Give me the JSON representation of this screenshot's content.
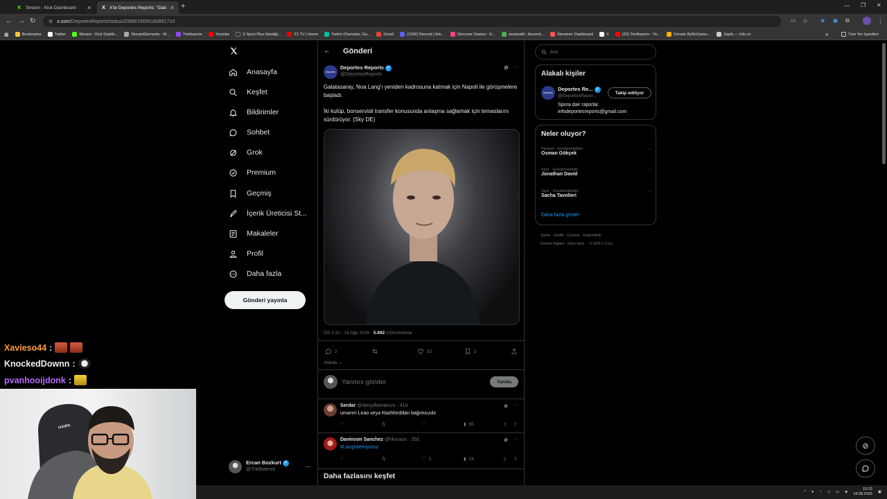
{
  "browser": {
    "tabs": [
      {
        "label": "Stream - Kick Dashboard",
        "favicon": "K"
      },
      {
        "label": "X'te Deportes Reports: \"Galata...",
        "favicon": "X"
      }
    ],
    "new_tab": "+",
    "url_domain": "x.com",
    "url_path": "/DeportesReports/status/2089676656180891710",
    "bookmarks": [
      "Bookmarks",
      "Twitter",
      "Stream - Kick Dashb...",
      "StreamElements - M...",
      "Trielbaenre",
      "Youtube",
      "S Sport Plus-İstediği...",
      "F1 TV | Home",
      "Twitch Channels, Ga...",
      "Gmail",
      "(1342) Discord | Ark...",
      "Discover Games - K...",
      "wowaudit - Ascend...",
      "Streamer Dashboard",
      "X",
      "(23) Trielbaenre - Yo...",
      "Donate ByNoGame...",
      "Sayfa — hits.co"
    ],
    "bookmarks_more": "»",
    "all_bookmarks": "Tüm Yer İşaretleri"
  },
  "nav": {
    "items": [
      "Anasayfa",
      "Keşfet",
      "Bildirimler",
      "Sohbet",
      "Grok",
      "Premium",
      "Geçmiş",
      "İçerik Üreticisi St...",
      "Makaleler",
      "Profil",
      "Daha fazla"
    ],
    "post_button": "Gönderi yayınla",
    "account_name": "Ercan Bozkurt",
    "account_handle": "@Trielbaenre",
    "account_more": "···"
  },
  "post": {
    "header_title": "Gönderi",
    "author_name": "Deportes Reports",
    "author_handle": "@DeportesReports",
    "avatar_text": "Deportes",
    "text_p1": "Galatasaray, Noa Lang'ı yeniden kadrosuna katmak için Napoli ile görüşmelere başladı.",
    "text_p2": "İki kulüp, bonservisli transfer konusunda anlaşma sağlamak için temaslarını sürdürüyor. (Sky DE)",
    "timestamp": "ÖS 2:31 · 18 Ağu 2026 ·",
    "views_count": "5.892",
    "views_label": "Görüntüleme",
    "replies": "2",
    "likes": "32",
    "bookmarks": "2",
    "related_label": "Alakalı",
    "reply_placeholder": "Yanıtını gönder",
    "reply_button": "Yanıtla"
  },
  "replies": [
    {
      "name": "Serdar",
      "handle": "@AlexyBatrakovv",
      "time": "· 41d",
      "text": "umarım Leao veya Rashforddan bağımsızdır",
      "likes": "",
      "views": "85"
    },
    {
      "name": "Davinson Sanchez",
      "handle": "@hkoraus",
      "time": "· 26d",
      "text": "#LangIstemiyoruz",
      "likes": "1",
      "views": "24"
    }
  ],
  "discover_more": "Daha fazlasını keşfet",
  "sidebar": {
    "search_placeholder": "Ara",
    "related_title": "Alakalı kişiler",
    "related_name": "Deportes Re...",
    "related_handle": "@DeportesRepor...",
    "follow_button": "Takip ediliyor",
    "related_bio_1": "Spora dair raporlar.",
    "related_bio_2": "infodeportesreports@gmail.com",
    "trends_title": "Neler oluyor?",
    "trends": [
      {
        "category": "Siyaset · Gündemdekiler",
        "name": "Osman Gökçek"
      },
      {
        "category": "Spor · Gündemdekiler",
        "name": "Jonathan David"
      },
      {
        "category": "Spor · Gündemdekiler",
        "name": "Sacha Tavolieri"
      }
    ],
    "show_more": "Daha fazla göster",
    "footer_1": "Şartlar · Gizlilik · Çerezler · Erişilebilirlik ·",
    "footer_2": "Reklam Bilgileri · Daha fazla ··· © 2026 X Corp."
  },
  "chat": [
    {
      "user": "Xavieso44",
      "color": "#ff9d3c",
      "sep": ":"
    },
    {
      "user": "KnockedDownn",
      "color": "#f0f0f0",
      "sep": ":"
    },
    {
      "user": "pvanhooijdonk",
      "color": "#b469ff",
      "sep": ":"
    }
  ],
  "webcam": {
    "chair_brand": "HAWK"
  },
  "taskbar": {
    "time": "15:23",
    "date": "18.08.2026"
  },
  "colors": {
    "accent": "#1d9bf0",
    "bg": "#000000",
    "border": "#2f3336",
    "muted": "#71767b"
  }
}
